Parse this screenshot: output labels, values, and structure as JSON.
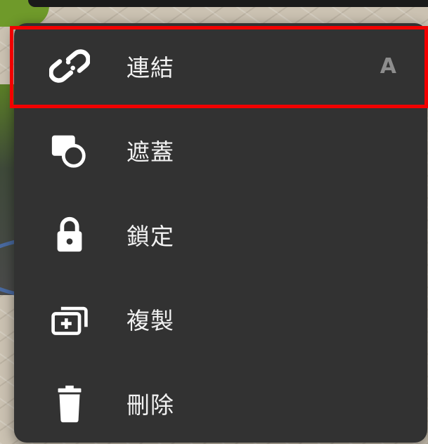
{
  "menu": {
    "items": [
      {
        "label": "連結",
        "icon": "link-icon",
        "shortcut": "A"
      },
      {
        "label": "遮蓋",
        "icon": "mask-icon"
      },
      {
        "label": "鎖定",
        "icon": "lock-icon"
      },
      {
        "label": "複製",
        "icon": "duplicate-icon"
      },
      {
        "label": "刪除",
        "icon": "trash-icon"
      }
    ]
  },
  "colors": {
    "menu_background": "#323232",
    "text": "#f2f2f2",
    "shortcut": "#8d8d8d",
    "highlight": "#f20000"
  }
}
